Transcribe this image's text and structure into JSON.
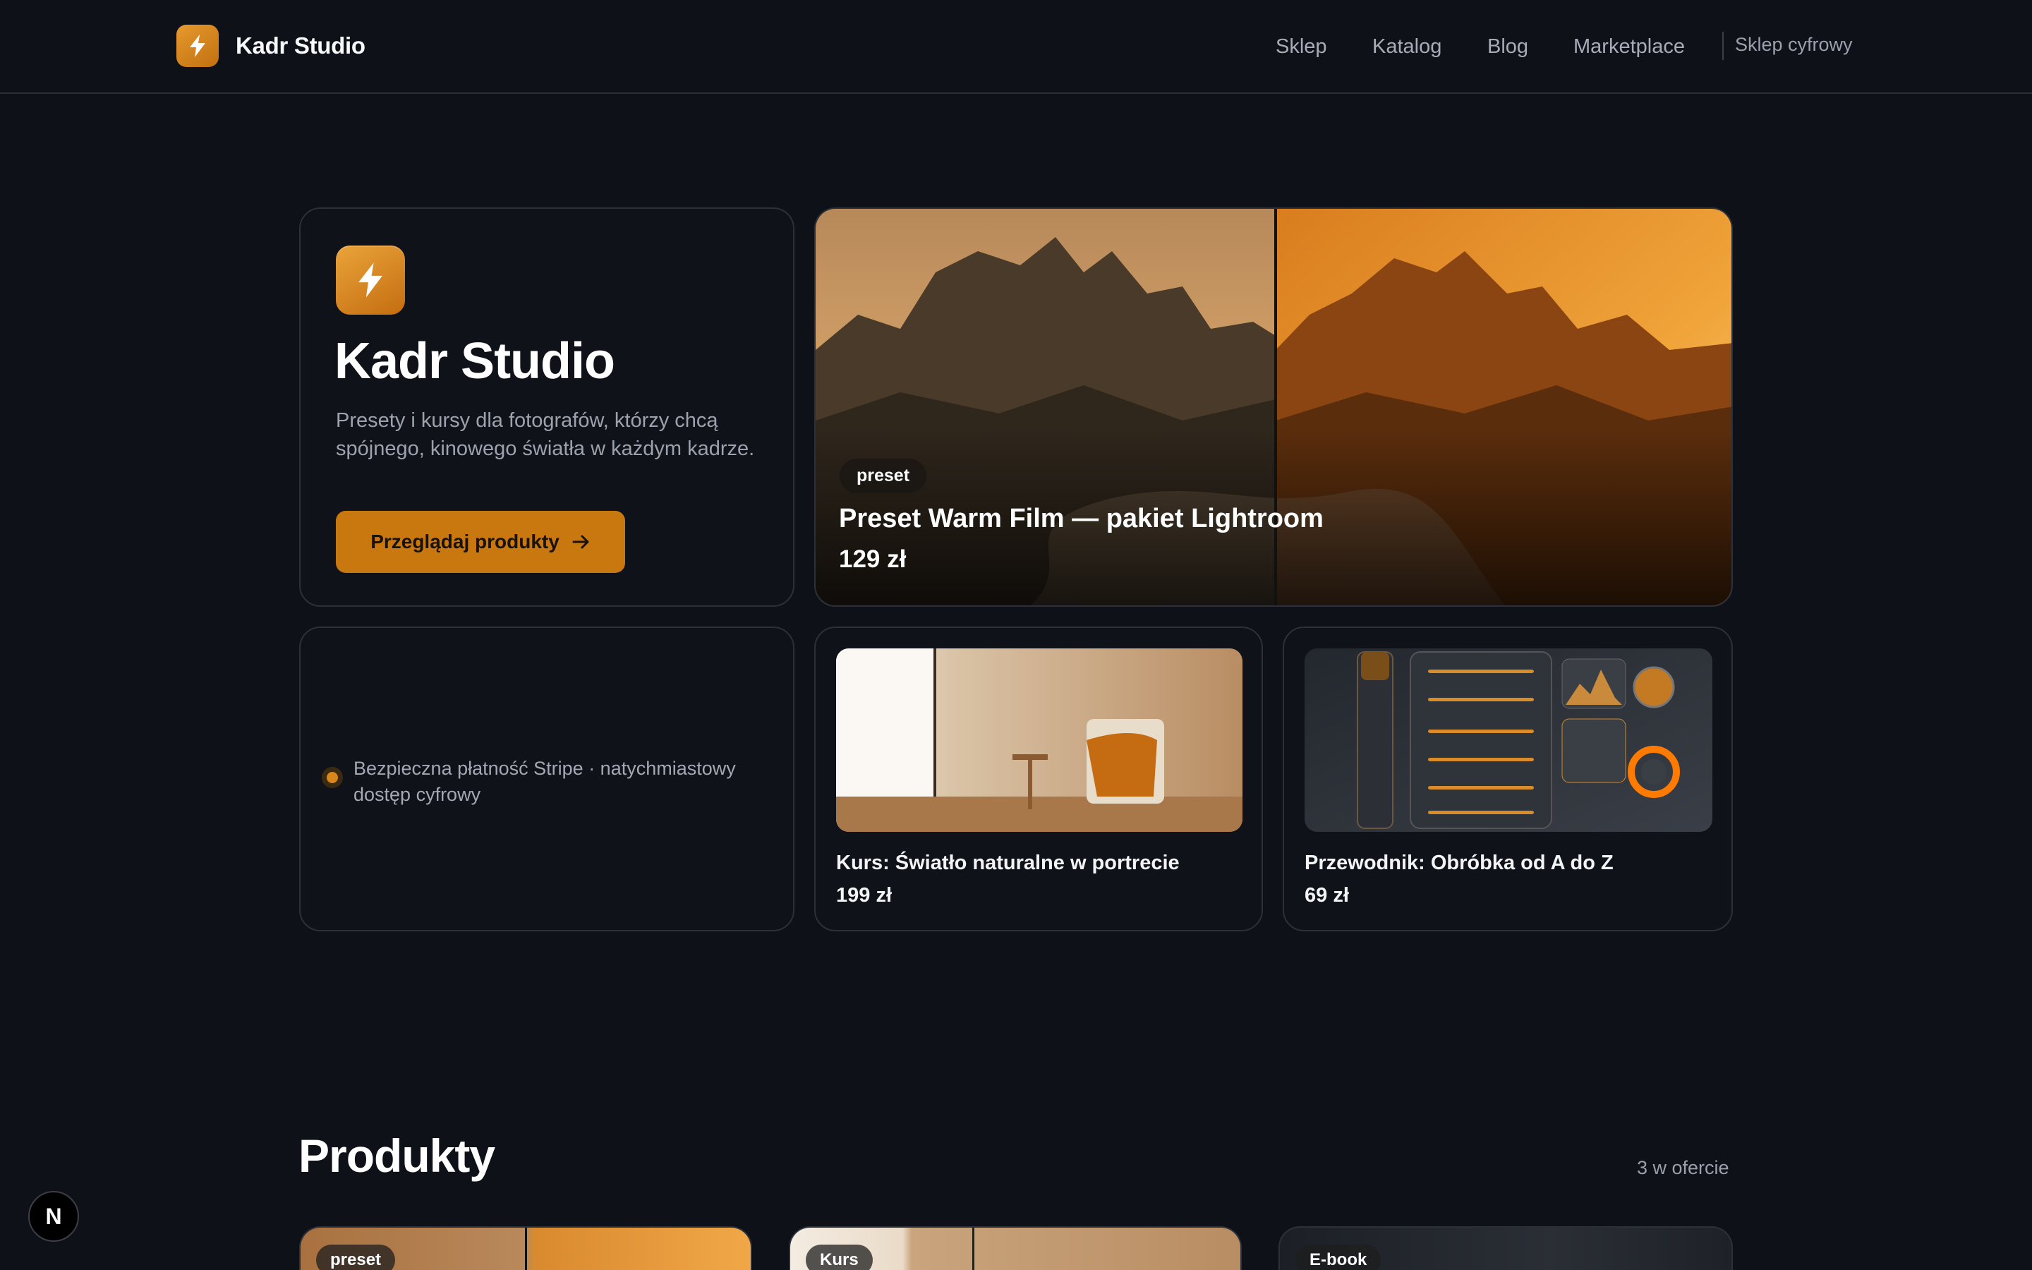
{
  "nav": {
    "brand": "Kadr Studio",
    "links": [
      {
        "label": "Sklep"
      },
      {
        "label": "Katalog"
      },
      {
        "label": "Blog"
      },
      {
        "label": "Marketplace"
      }
    ],
    "tag": "Sklep cyfrowy"
  },
  "intro": {
    "title": "Kadr Studio",
    "description": "Presety i kursy dla fotografów, którzy chcą spójnego, kinowego światła w każdym kadrze.",
    "cta_label": "Przeglądaj produkty",
    "cta_icon": "arrow-right-icon"
  },
  "hero": {
    "badge": "preset",
    "title": "Preset Warm Film — pakiet Lightroom",
    "price": "129 zł"
  },
  "info": {
    "text": "Bezpieczna płatność Stripe · natychmiastowy dostęp cyfrowy"
  },
  "products_featured": [
    {
      "title": "Kurs: Światło naturalne w portrecie",
      "price": "199 zł"
    },
    {
      "title": "Przewodnik: Obróbka od A do Z",
      "price": "69 zł"
    }
  ],
  "products_section": {
    "title": "Produkty",
    "count": "3 w ofercie",
    "cards": [
      {
        "badge": "preset"
      },
      {
        "badge": "Kurs"
      },
      {
        "badge": "E-book"
      }
    ]
  },
  "floating": {
    "label": "N"
  },
  "colors": {
    "background": "#0e1117",
    "accent": "#c9780f",
    "border": "#2b303a"
  }
}
